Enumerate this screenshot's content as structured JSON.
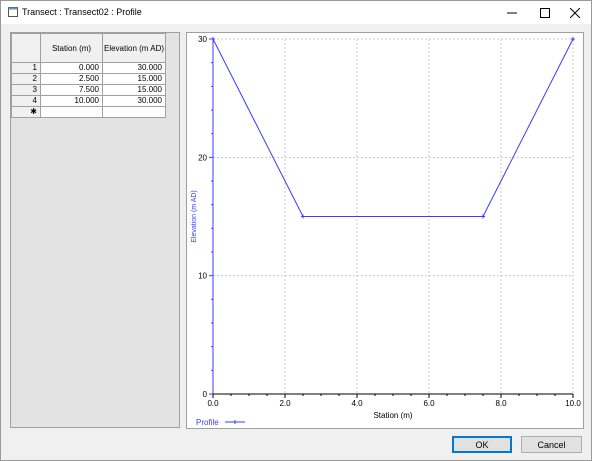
{
  "window": {
    "title": "Transect : Transect02 : Profile",
    "icon": "window-app-icon"
  },
  "grid": {
    "columns": [
      "Station (m)",
      "Elevation (m AD)"
    ],
    "rows": [
      {
        "num": "1",
        "station": "0.000",
        "elevation": "30.000"
      },
      {
        "num": "2",
        "station": "2.500",
        "elevation": "15.000"
      },
      {
        "num": "3",
        "station": "7.500",
        "elevation": "15.000"
      },
      {
        "num": "4",
        "station": "10.000",
        "elevation": "30.000"
      }
    ],
    "new_row_marker": "✱"
  },
  "chart_data": {
    "type": "line",
    "xlabel": "Station (m)",
    "ylabel": "Elevation (m AD)",
    "xlim": [
      0,
      10
    ],
    "ylim": [
      0,
      30
    ],
    "x_ticks": [
      "0.0",
      "2.0",
      "4.0",
      "6.0",
      "8.0",
      "10.0"
    ],
    "y_ticks": [
      "0",
      "10",
      "20",
      "30"
    ],
    "grid": true,
    "legend": "bottom-left",
    "series": [
      {
        "name": "Profile",
        "x": [
          0,
          2.5,
          7.5,
          10
        ],
        "y": [
          30,
          15,
          15,
          30
        ],
        "color": "#3b3bff"
      }
    ]
  },
  "buttons": {
    "ok": "OK",
    "cancel": "Cancel"
  },
  "colors": {
    "series": "#3b3bff",
    "grid": "#c8c8c8",
    "accent": "#0078d7"
  }
}
